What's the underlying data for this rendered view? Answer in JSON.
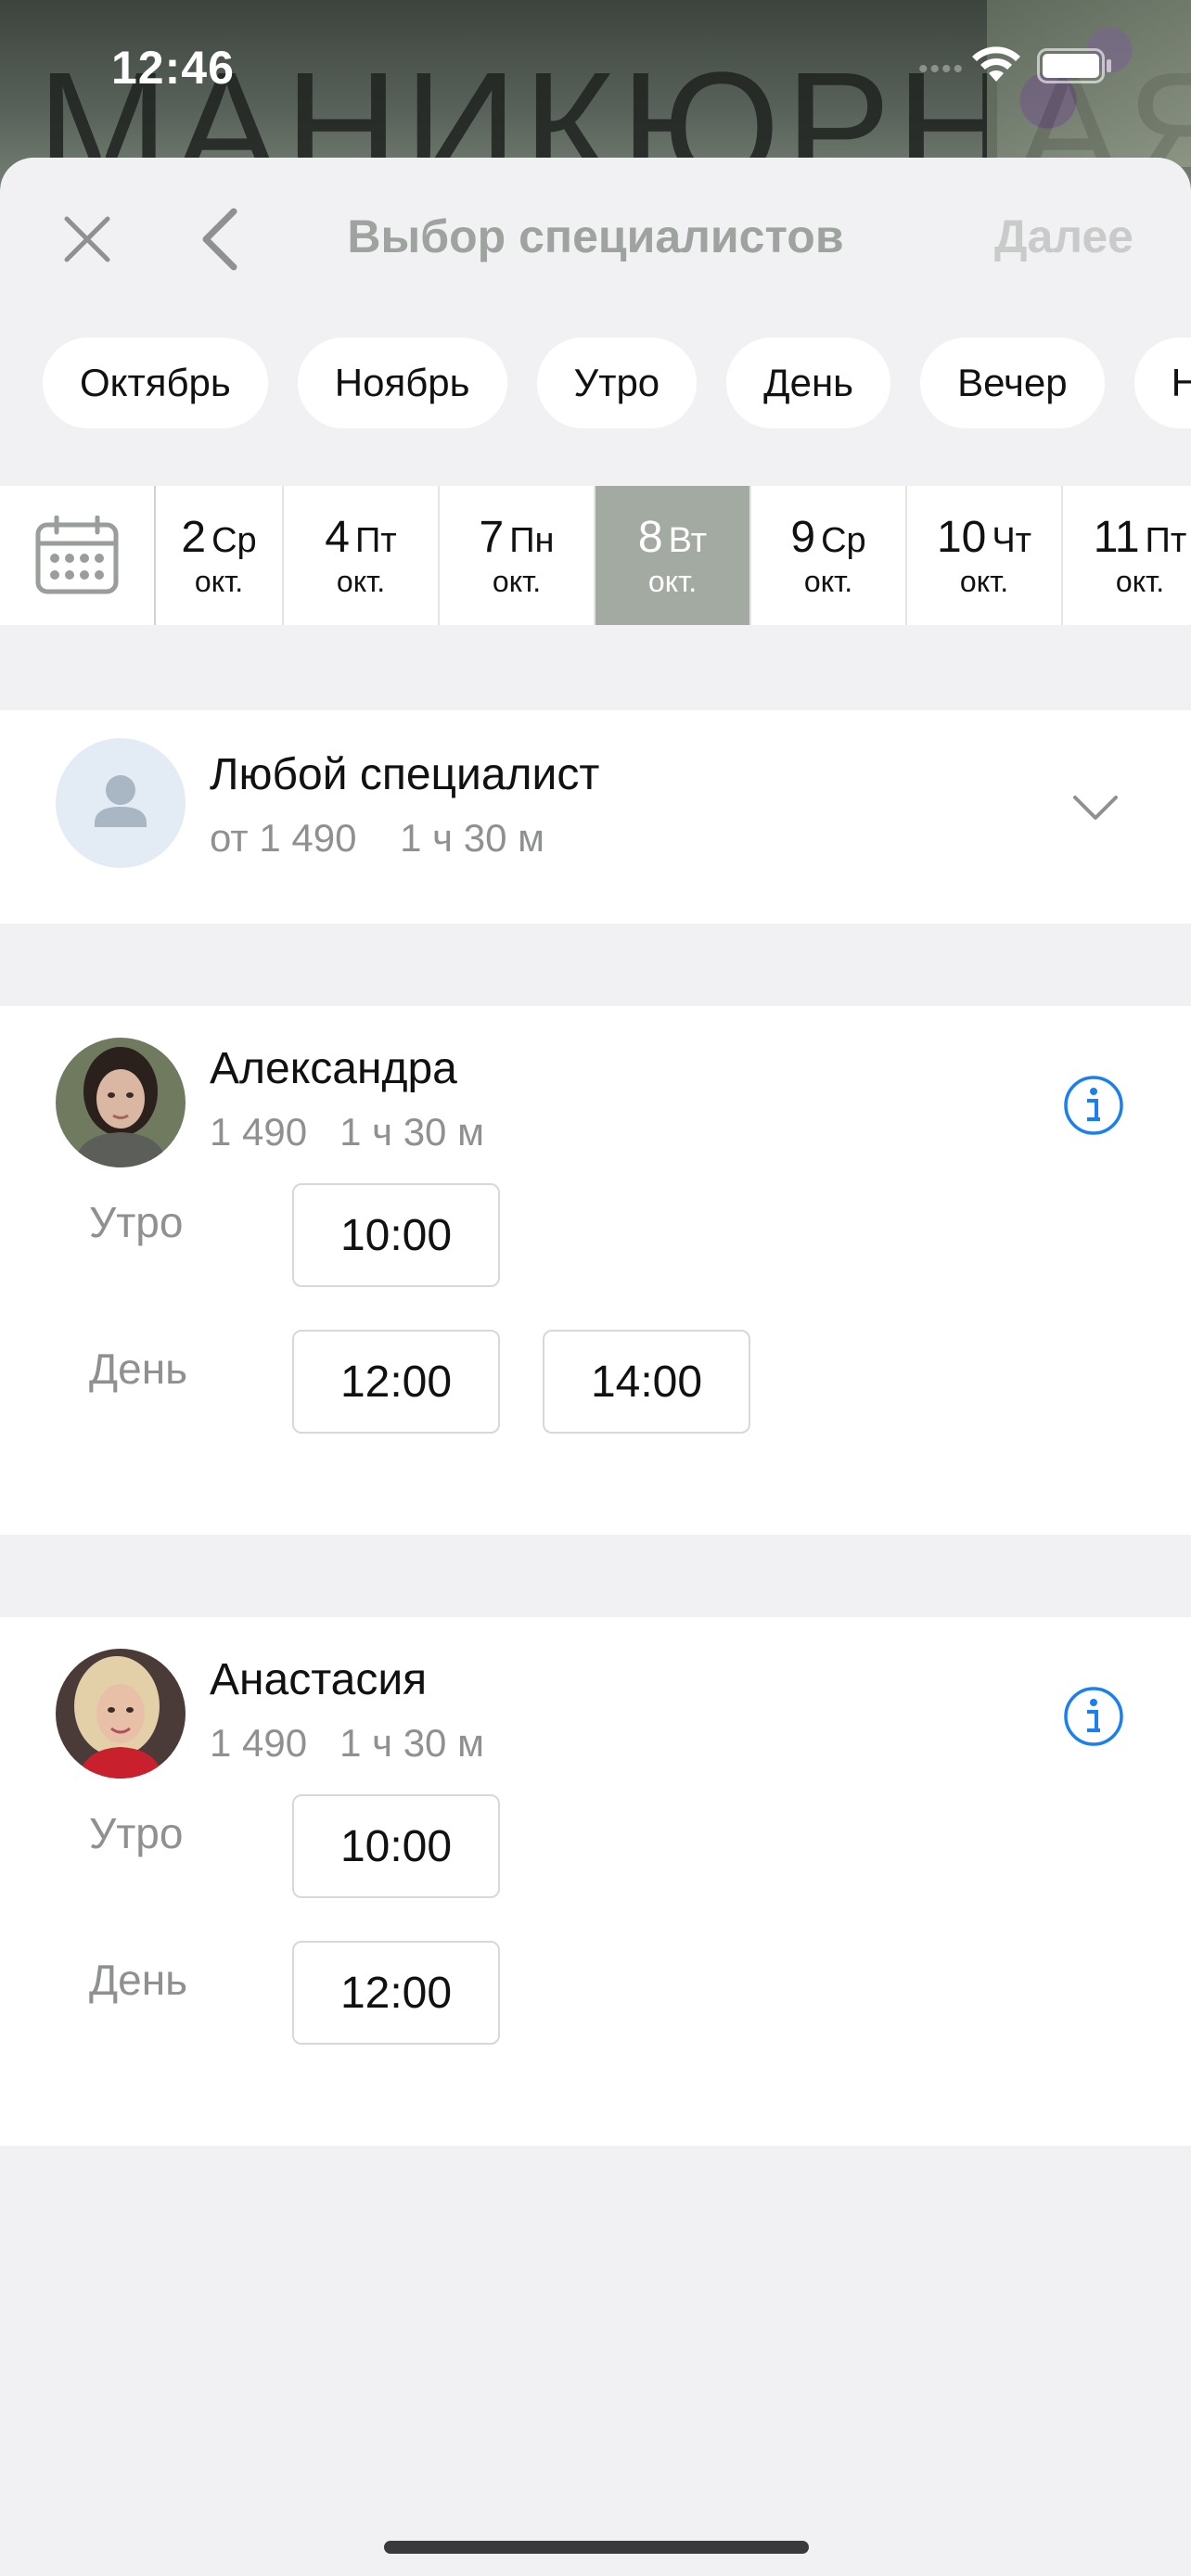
{
  "status": {
    "time": "12:46"
  },
  "background": {
    "text": "МАНИКЮРНАЯ"
  },
  "header": {
    "title": "Выбор специалистов",
    "next_label": "Далее"
  },
  "filters": [
    "Октябрь",
    "Ноябрь",
    "Утро",
    "День",
    "Вечер",
    "Но"
  ],
  "dates": [
    {
      "num": "2",
      "dow": "Ср",
      "month": "окт."
    },
    {
      "num": "4",
      "dow": "Пт",
      "month": "окт."
    },
    {
      "num": "7",
      "dow": "Пн",
      "month": "окт."
    },
    {
      "num": "8",
      "dow": "Вт",
      "month": "окт.",
      "selected": true
    },
    {
      "num": "9",
      "dow": "Ср",
      "month": "окт."
    },
    {
      "num": "10",
      "dow": "Чт",
      "month": "окт."
    },
    {
      "num": "11",
      "dow": "Пт",
      "month": "окт."
    }
  ],
  "any_specialist": {
    "name": "Любой специалист",
    "price": "от 1 490",
    "duration": "1 ч 30 м"
  },
  "specialists": [
    {
      "name": "Александра",
      "price": "1 490",
      "duration": "1 ч 30 м",
      "morning_label": "Утро",
      "morning_slots": [
        "10:00"
      ],
      "day_label": "День",
      "day_slots": [
        "12:00",
        "14:00"
      ]
    },
    {
      "name": "Анастасия",
      "price": "1 490",
      "duration": "1 ч 30 м",
      "morning_label": "Утро",
      "morning_slots": [
        "10:00"
      ],
      "day_label": "День",
      "day_slots": [
        "12:00"
      ]
    }
  ],
  "colors": {
    "accent_info": "#1a7ff0",
    "selected_date": "#a3aaa1",
    "sheet_bg": "#f1f1f4"
  }
}
